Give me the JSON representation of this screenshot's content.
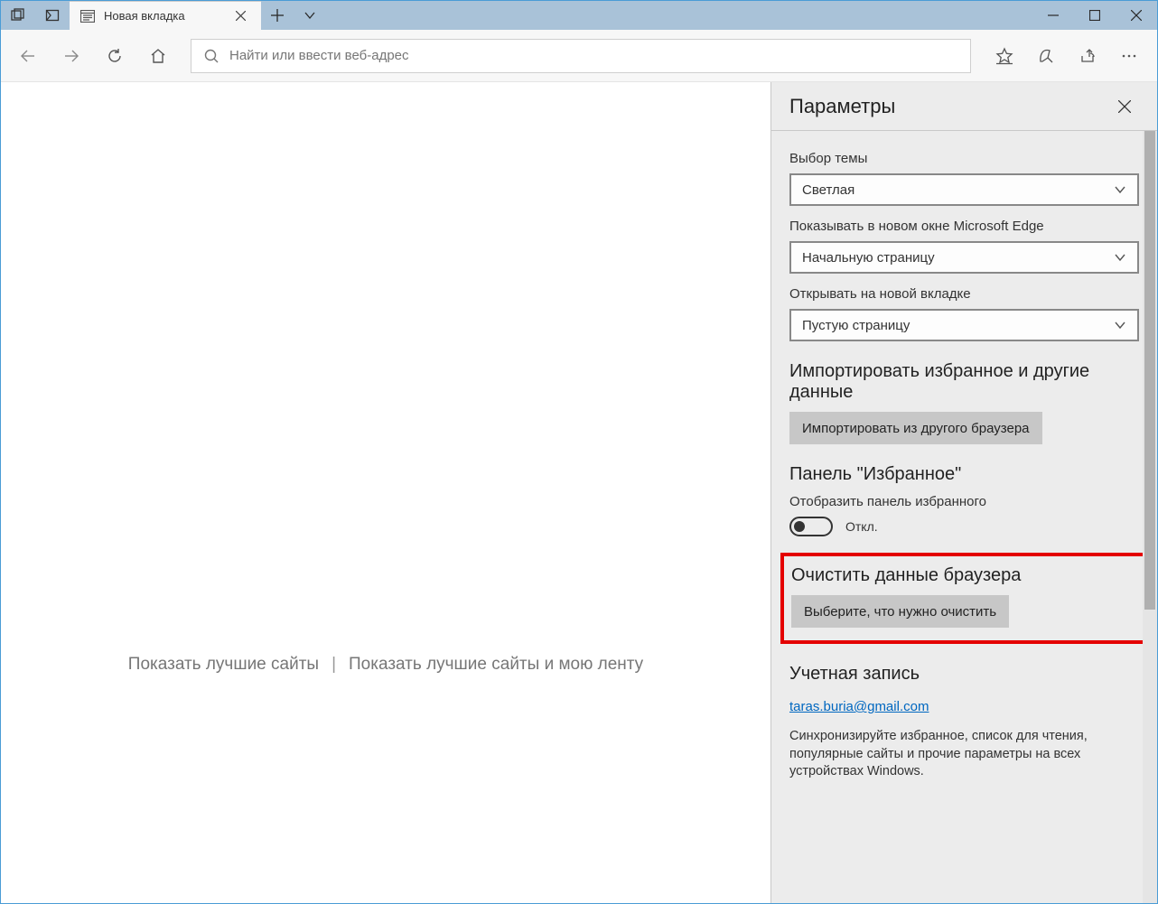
{
  "tab": {
    "title": "Новая вкладка"
  },
  "addressbar": {
    "placeholder": "Найти или ввести веб-адрес"
  },
  "start": {
    "link1": "Показать лучшие сайты",
    "link2": "Показать лучшие сайты и мою ленту"
  },
  "panel": {
    "title": "Параметры",
    "theme": {
      "label": "Выбор темы",
      "value": "Светлая"
    },
    "newwin": {
      "label": "Показывать в новом окне Microsoft Edge",
      "value": "Начальную страницу"
    },
    "newtab": {
      "label": "Открывать на новой вкладке",
      "value": "Пустую страницу"
    },
    "import": {
      "title": "Импортировать избранное и другие данные",
      "button": "Импортировать из другого браузера"
    },
    "favbar": {
      "title": "Панель \"Избранное\"",
      "label": "Отобразить панель избранного",
      "state": "Откл."
    },
    "clear": {
      "title": "Очистить данные браузера",
      "button": "Выберите, что нужно очистить"
    },
    "account": {
      "title": "Учетная запись",
      "email": "taras.buria@gmail.com",
      "desc": "Синхронизируйте избранное, список для чтения, популярные сайты и прочие параметры на всех устройствах Windows."
    }
  }
}
